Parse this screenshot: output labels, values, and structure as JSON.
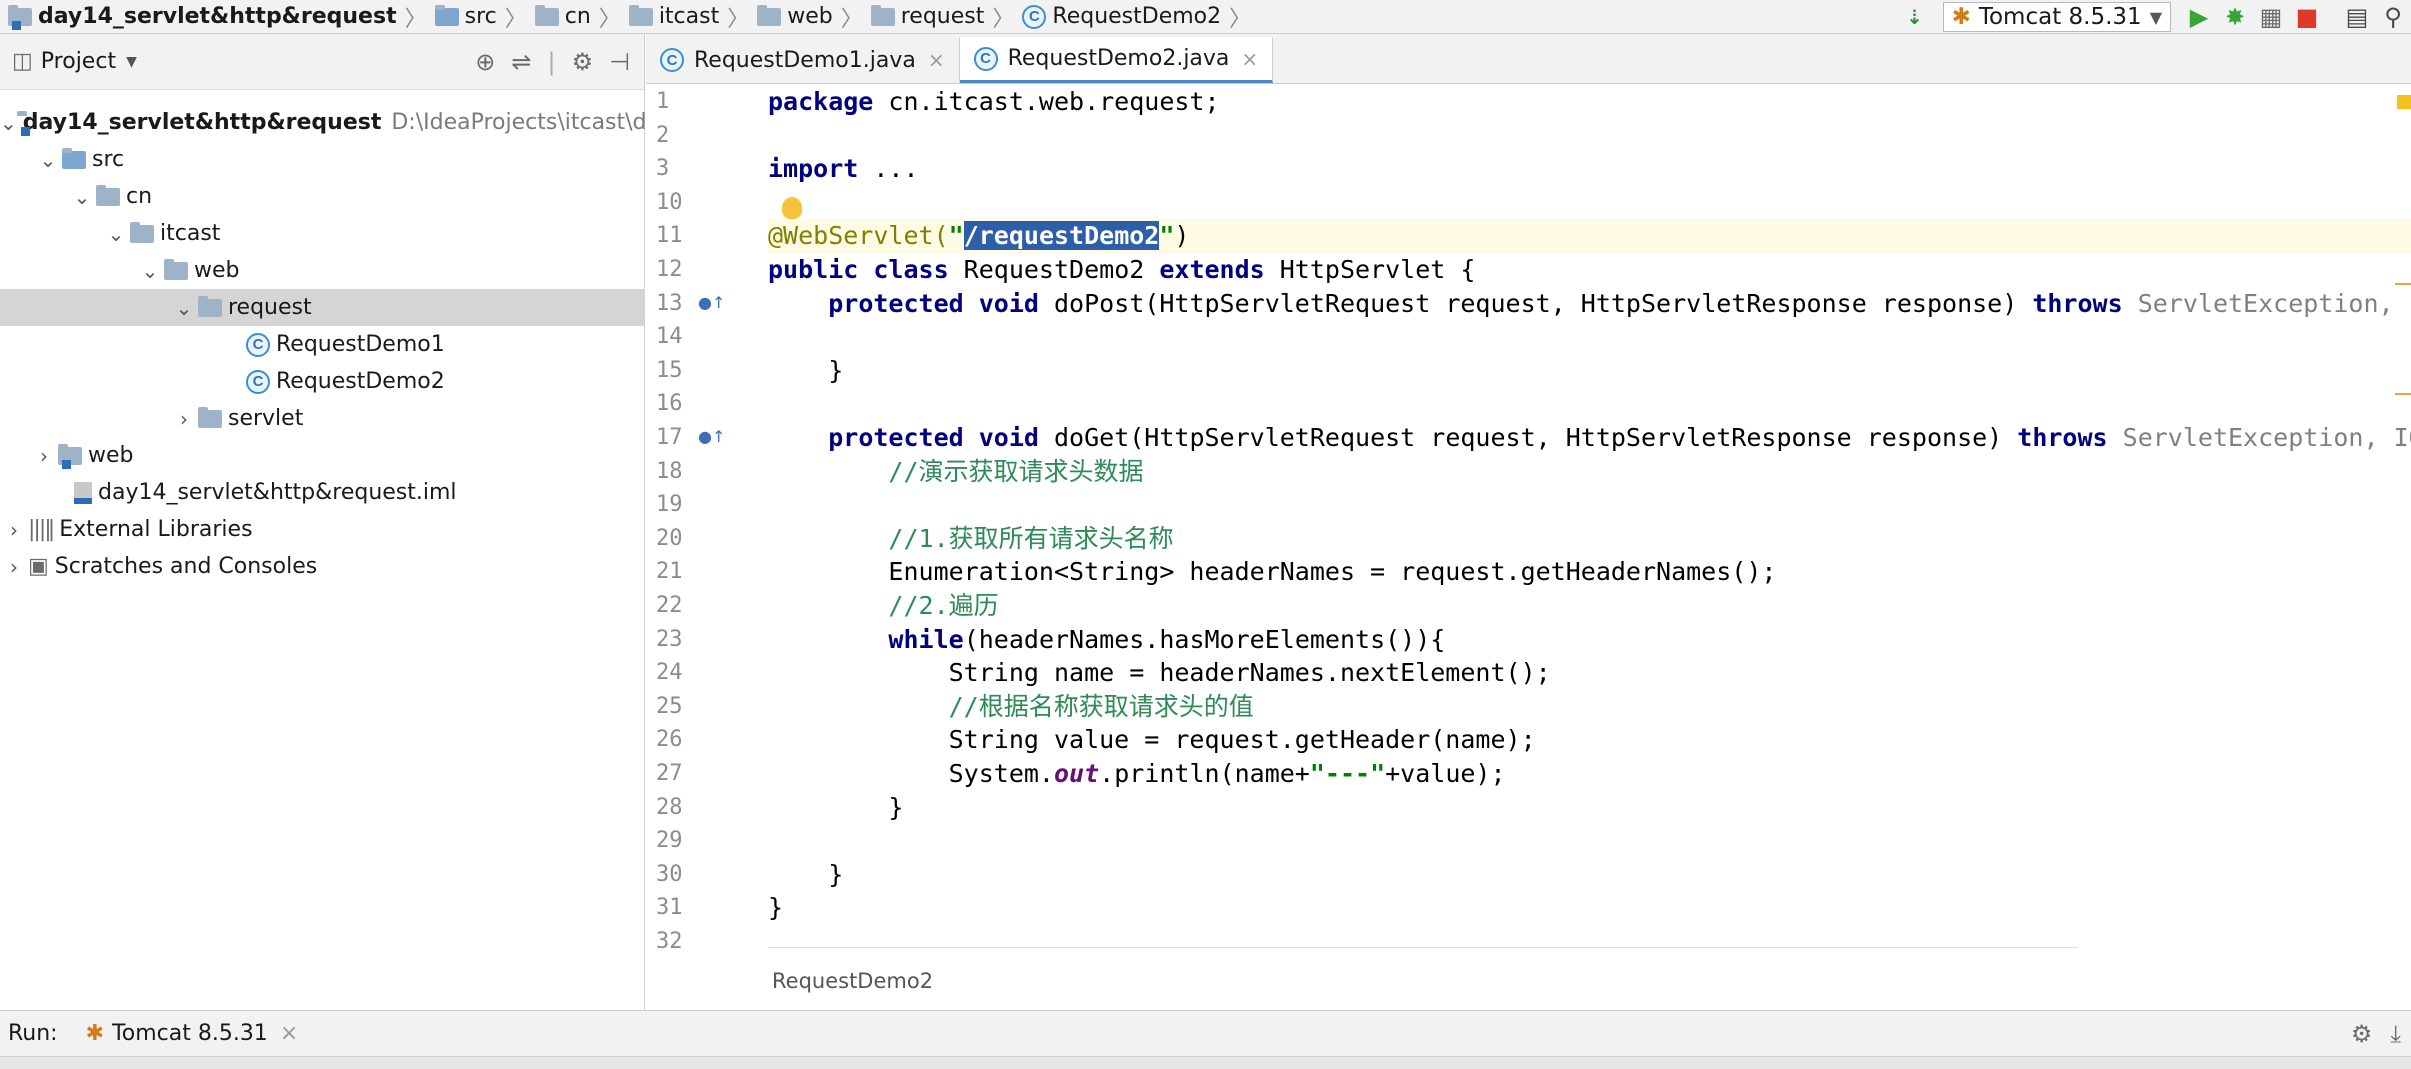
{
  "navbar": {
    "breadcrumbs": [
      "day14_servlet&http&request",
      "src",
      "cn",
      "itcast",
      "web",
      "request",
      "RequestDemo2"
    ],
    "run_config": "Tomcat 8.5.31"
  },
  "project": {
    "title": "Project",
    "tree": [
      {
        "label": "day14_servlet&http&request",
        "path": "D:\\IdeaProjects\\itcast\\da"
      },
      {
        "label": "src"
      },
      {
        "label": "cn"
      },
      {
        "label": "itcast"
      },
      {
        "label": "web"
      },
      {
        "label": "request"
      },
      {
        "label": "RequestDemo1"
      },
      {
        "label": "RequestDemo2"
      },
      {
        "label": "servlet"
      },
      {
        "label": "web"
      },
      {
        "label": "day14_servlet&http&request.iml"
      },
      {
        "label": "External Libraries"
      },
      {
        "label": "Scratches and Consoles"
      }
    ]
  },
  "tabs": [
    {
      "label": "RequestDemo1.java",
      "close": "×"
    },
    {
      "label": "RequestDemo2.java",
      "close": "×"
    }
  ],
  "editor": {
    "line_numbers": [
      "1",
      "2",
      "3",
      "10",
      "11",
      "12",
      "13",
      "14",
      "15",
      "16",
      "17",
      "18",
      "19",
      "20",
      "21",
      "22",
      "23",
      "24",
      "25",
      "26",
      "27",
      "28",
      "29",
      "30",
      "31",
      "32"
    ],
    "code": {
      "l1_kw": "package",
      "l1_rest": " cn.itcast.web.request;",
      "l3_kw": "import",
      "l3_rest": " ...",
      "l11_ann": "@WebServlet(",
      "l11_q1": "\"",
      "l11_sel": "/requestDemo2",
      "l11_q2": "\"",
      "l11_end": ")",
      "l12_kw1": "public class",
      "l12_name": " RequestDemo2 ",
      "l12_kw2": "extends",
      "l12_rest": " HttpServlet {",
      "l13_indent": "    ",
      "l13_kw": "protected void",
      "l13_rest": " doPost(HttpServletRequest request, HttpServletResponse response) ",
      "l13_kw2": "throws",
      "l13_exc": " ServletException, IOException {",
      "l15": "    }",
      "l17_indent": "    ",
      "l17_kw": "protected void",
      "l17_rest": " doGet(HttpServletRequest request, HttpServletResponse response) ",
      "l17_kw2": "throws",
      "l17_exc": " ServletException, IOException {",
      "l18_indent": "        ",
      "l18": "//演示获取请求头数据",
      "l20_indent": "        ",
      "l20": "//1.获取所有请求头名称",
      "l21": "        Enumeration<String> headerNames = request.getHeaderNames();",
      "l22_indent": "        ",
      "l22": "//2.遍历",
      "l23_indent": "        ",
      "l23_kw": "while",
      "l23_rest": "(headerNames.hasMoreElements()){",
      "l24": "            String name = headerNames.nextElement();",
      "l25_indent": "            ",
      "l25": "//根据名称获取请求头的值",
      "l26": "            String value = request.getHeader(name);",
      "l27_a": "            System.",
      "l27_out": "out",
      "l27_b": ".println(name+",
      "l27_str": "\"---\"",
      "l27_c": "+value);",
      "l28": "        }",
      "l30": "    }",
      "l31": "}"
    },
    "crumb": "RequestDemo2"
  },
  "runbar": {
    "label": "Run:",
    "config": "Tomcat 8.5.31",
    "close": "×"
  }
}
